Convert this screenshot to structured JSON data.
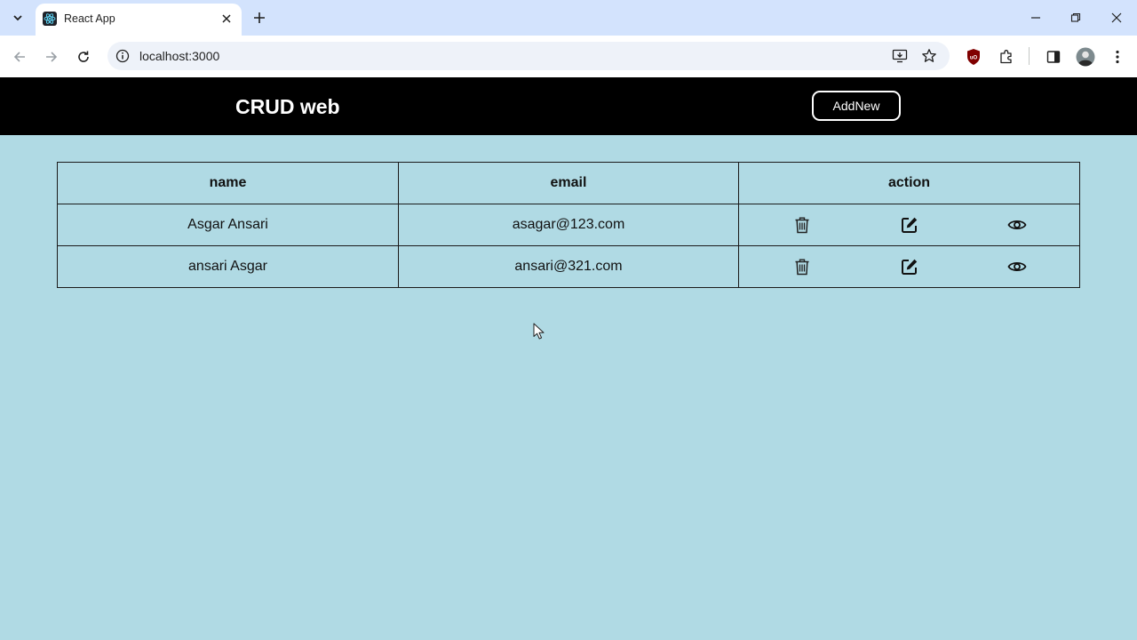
{
  "browser": {
    "tab_title": "React App",
    "url": "localhost:3000"
  },
  "app": {
    "title": "CRUD web",
    "add_button_label": "AddNew"
  },
  "table": {
    "headers": {
      "name": "name",
      "email": "email",
      "action": "action"
    },
    "rows": [
      {
        "name": "Asgar Ansari",
        "email": "asagar@123.com"
      },
      {
        "name": "ansari Asgar",
        "email": "ansari@321.com"
      }
    ]
  },
  "icons": {
    "delete": "trash-icon",
    "edit": "edit-icon",
    "view": "eye-icon"
  },
  "colors": {
    "page_background": "#b0dae4",
    "header_background": "#000000",
    "tabstrip": "#d3e3fd"
  }
}
